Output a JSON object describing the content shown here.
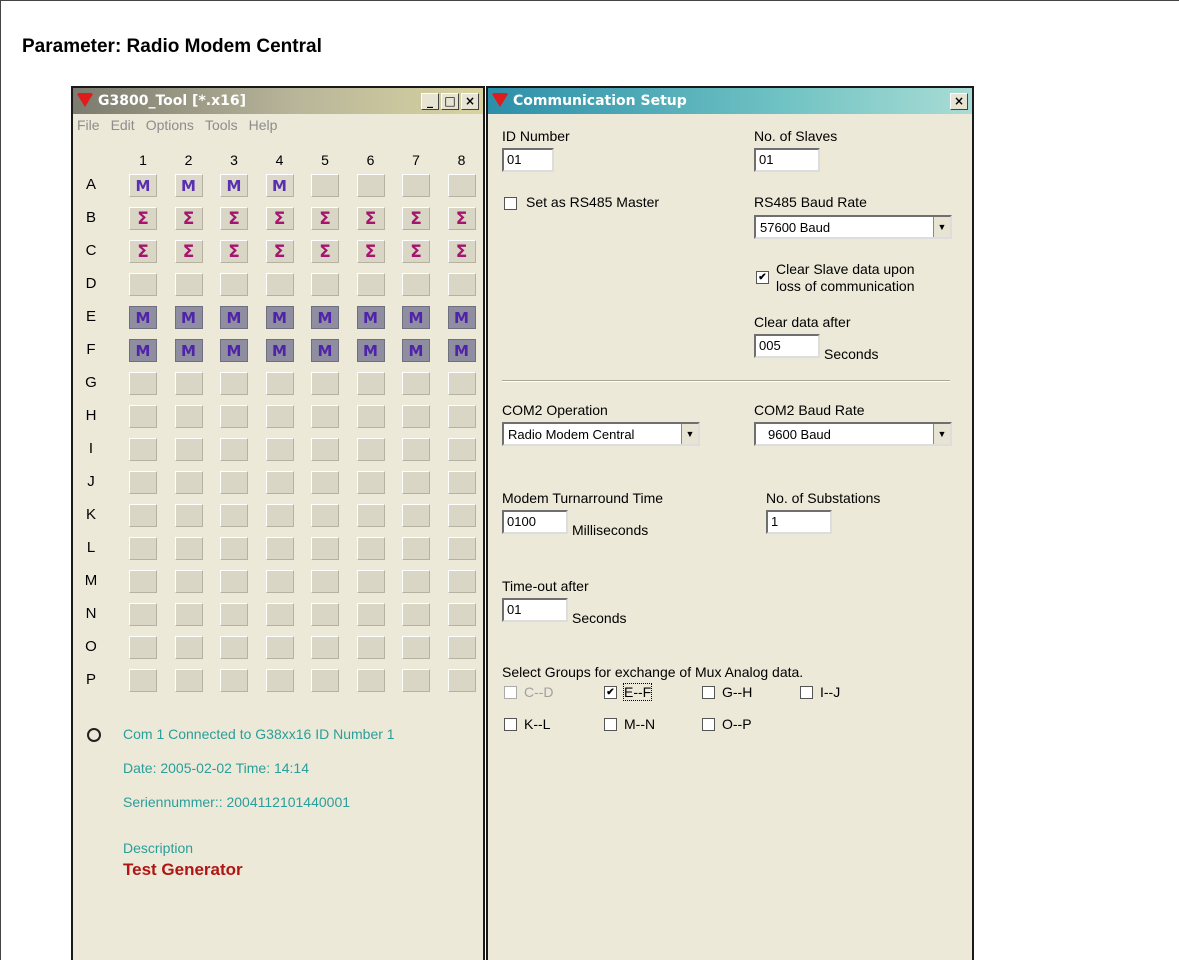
{
  "page": {
    "title": "Parameter: Radio Modem Central"
  },
  "tool_window": {
    "title": "G3800_Tool [*.x16]",
    "menu": [
      "File",
      "Edit",
      "Options",
      "Tools",
      "Help"
    ],
    "columns": [
      "1",
      "2",
      "3",
      "4",
      "5",
      "6",
      "7",
      "8"
    ],
    "rows": [
      {
        "label": "A",
        "cells": [
          "M",
          "M",
          "M",
          "M",
          "",
          "",
          "",
          ""
        ]
      },
      {
        "label": "B",
        "cells": [
          "Σ",
          "Σ",
          "Σ",
          "Σ",
          "Σ",
          "Σ",
          "Σ",
          "Σ"
        ]
      },
      {
        "label": "C",
        "cells": [
          "Σ",
          "Σ",
          "Σ",
          "Σ",
          "Σ",
          "Σ",
          "Σ",
          "Σ"
        ]
      },
      {
        "label": "D",
        "cells": [
          "",
          "",
          "",
          "",
          "",
          "",
          "",
          ""
        ]
      },
      {
        "label": "E",
        "cells": [
          "M",
          "M",
          "M",
          "M",
          "M",
          "M",
          "M",
          "M"
        ]
      },
      {
        "label": "F",
        "cells": [
          "M",
          "M",
          "M",
          "M",
          "M",
          "M",
          "M",
          "M"
        ]
      },
      {
        "label": "G",
        "cells": [
          "",
          "",
          "",
          "",
          "",
          "",
          "",
          ""
        ]
      },
      {
        "label": "H",
        "cells": [
          "",
          "",
          "",
          "",
          "",
          "",
          "",
          ""
        ]
      },
      {
        "label": "I",
        "cells": [
          "",
          "",
          "",
          "",
          "",
          "",
          "",
          ""
        ]
      },
      {
        "label": "J",
        "cells": [
          "",
          "",
          "",
          "",
          "",
          "",
          "",
          ""
        ]
      },
      {
        "label": "K",
        "cells": [
          "",
          "",
          "",
          "",
          "",
          "",
          "",
          ""
        ]
      },
      {
        "label": "L",
        "cells": [
          "",
          "",
          "",
          "",
          "",
          "",
          "",
          ""
        ]
      },
      {
        "label": "M",
        "cells": [
          "",
          "",
          "",
          "",
          "",
          "",
          "",
          ""
        ]
      },
      {
        "label": "N",
        "cells": [
          "",
          "",
          "",
          "",
          "",
          "",
          "",
          ""
        ]
      },
      {
        "label": "O",
        "cells": [
          "",
          "",
          "",
          "",
          "",
          "",
          "",
          ""
        ]
      },
      {
        "label": "P",
        "cells": [
          "",
          "",
          "",
          "",
          "",
          "",
          "",
          ""
        ]
      }
    ],
    "status": {
      "connection": "Com 1 Connected to  G38xx16 ID Number 1",
      "datetime": "Date: 2005-02-02  Time: 14:14",
      "serial": "Seriennummer:: 2004112101440001",
      "description_label": "Description",
      "description_value": "Test Generator"
    }
  },
  "comm_window": {
    "title": "Communication Setup",
    "id_number": {
      "label": "ID Number",
      "value": "01"
    },
    "slaves": {
      "label": "No. of Slaves",
      "value": "01"
    },
    "rs485_master": {
      "label": "Set as RS485 Master",
      "checked": false
    },
    "rs485_baud": {
      "label": "RS485 Baud Rate",
      "value": "57600 Baud"
    },
    "clear_slave": {
      "line1": "Clear Slave data upon",
      "line2": "loss of communication",
      "checked": true
    },
    "clear_after": {
      "label": "Clear data after",
      "value": "005",
      "unit": "Seconds"
    },
    "com2_operation": {
      "label": "COM2 Operation",
      "value": "Radio Modem Central"
    },
    "com2_baud": {
      "label": "COM2 Baud Rate",
      "value": "9600 Baud"
    },
    "turnaround": {
      "label": "Modem Turnarround Time",
      "value": "0100",
      "unit": "Milliseconds"
    },
    "substations": {
      "label": "No. of Substations",
      "value": "1"
    },
    "timeout": {
      "label": "Time-out after",
      "value": "01",
      "unit": "Seconds"
    },
    "groups": {
      "label": "Select Groups for exchange of Mux Analog data.",
      "items": [
        {
          "label": "C--D",
          "checked": false,
          "disabled": true
        },
        {
          "label": "E--F",
          "checked": true,
          "disabled": false
        },
        {
          "label": "G--H",
          "checked": false,
          "disabled": false
        },
        {
          "label": "I--J",
          "checked": false,
          "disabled": false
        },
        {
          "label": "K--L",
          "checked": false,
          "disabled": false
        },
        {
          "label": "M--N",
          "checked": false,
          "disabled": false
        },
        {
          "label": "O--P",
          "checked": false,
          "disabled": false
        }
      ]
    },
    "window_buttons": {
      "close": "×"
    }
  },
  "tool_window_buttons": {
    "minimize": "_",
    "maximize": "□",
    "close": "×"
  }
}
